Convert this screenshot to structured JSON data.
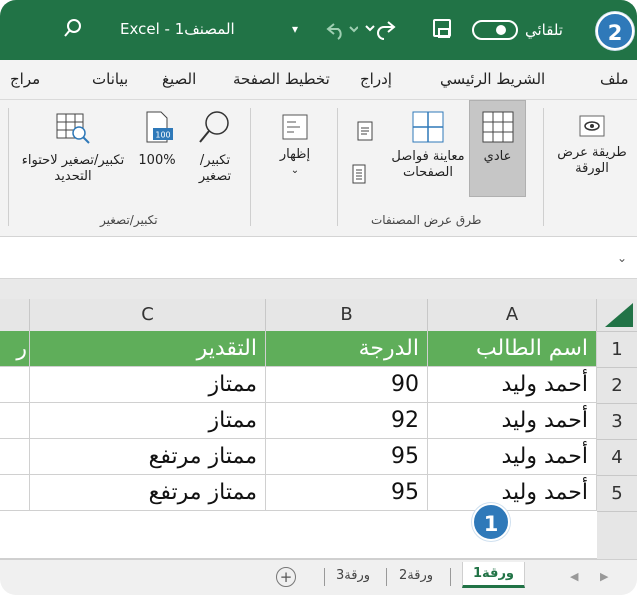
{
  "title_bar": {
    "title": "Excel - المصنف1",
    "autosave_label": "تلقائي",
    "colors": {
      "excel_green": "#217346"
    },
    "icons": [
      "search-icon",
      "customize-icon",
      "undo-icon",
      "redo-icon",
      "save-icon",
      "toggle-switch"
    ]
  },
  "badges": {
    "one": "1",
    "two": "2"
  },
  "tabs": [
    "ملف",
    "الشريط الرئيسي",
    "إدراج",
    "تخطيط الصفحة",
    "الصيغ",
    "بيانات",
    "مراج"
  ],
  "ribbon": {
    "view_mode_button": "طريقة عرض الورقة",
    "normal": "عادي",
    "page_break_preview": "معاينة فواصل الصفحات",
    "show": "إظهار",
    "zoom": "تكبير/ تصغير",
    "zoom_100": "100%",
    "zoom_to_selection": "تكبير/تصغير لاحتواء التحديد",
    "group_workbook_views": "طرق عرض المصنفات",
    "group_zoom": "تكبير/تصغير"
  },
  "grid": {
    "columns": [
      "A",
      "B",
      "C"
    ],
    "rows": [
      "1",
      "2",
      "3",
      "4",
      "5"
    ],
    "headers": {
      "A": "اسم الطالب",
      "B": "الدرجة",
      "C": "التقدير",
      "D": "ر"
    },
    "data": [
      {
        "name": "أحمد وليد",
        "score": "90",
        "grade": "ممتاز"
      },
      {
        "name": "أحمد وليد",
        "score": "92",
        "grade": "ممتاز"
      },
      {
        "name": "أحمد وليد",
        "score": "95",
        "grade": "ممتاز مرتفع"
      },
      {
        "name": "أحمد وليد",
        "score": "95",
        "grade": "ممتاز مرتفع"
      }
    ],
    "header_color": "#5fae5a"
  },
  "sheets": {
    "sheet1": "ورقة1",
    "sheet2": "ورقة2",
    "sheet3": "ورقة3",
    "add": "+"
  }
}
